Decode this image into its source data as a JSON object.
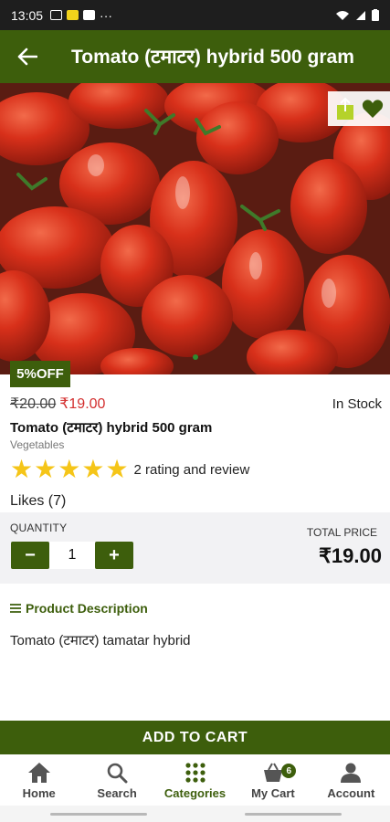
{
  "status_bar": {
    "time": "13:05",
    "dots": "···"
  },
  "appbar": {
    "title": "Tomato (टमाटर) hybrid 500 gram"
  },
  "product": {
    "discount_badge": "5%OFF",
    "old_price": "₹20.00",
    "new_price": "₹19.00",
    "stock": "In Stock",
    "name": "Tomato (टमाटर) hybrid 500 gram",
    "category": "Vegetables",
    "rating_stars": 5,
    "rating_text": "2 rating and review",
    "likes": "Likes (7)"
  },
  "quantity": {
    "label": "QUANTITY",
    "value": "1",
    "minus": "−",
    "plus": "+",
    "total_label": "TOTAL PRICE",
    "total_value": "₹19.00"
  },
  "description": {
    "title": "Product Description",
    "text": "Tomato (टमाटर) tamatar hybrid"
  },
  "cart_button": "ADD TO CART",
  "bottom_nav": {
    "items": [
      {
        "label": "Home",
        "icon": "home-icon"
      },
      {
        "label": "Search",
        "icon": "search-icon"
      },
      {
        "label": "Categories",
        "icon": "grid-icon"
      },
      {
        "label": "My Cart",
        "icon": "cart-icon",
        "badge": "6"
      },
      {
        "label": "Account",
        "icon": "account-icon"
      }
    ]
  },
  "colors": {
    "brand": "#3d5e0c",
    "price_red": "#d32f2f",
    "star": "#f5c518"
  }
}
